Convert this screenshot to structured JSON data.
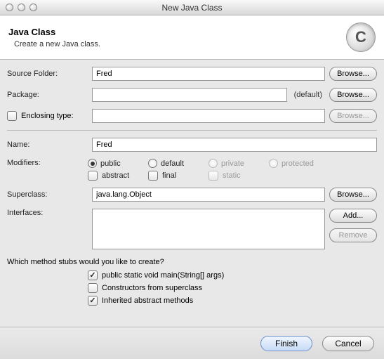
{
  "window": {
    "title": "New Java Class"
  },
  "header": {
    "title": "Java Class",
    "subtitle": "Create a new Java class.",
    "iconLetter": "C"
  },
  "labels": {
    "sourceFolder": "Source Folder:",
    "package": "Package:",
    "enclosingType": "Enclosing type:",
    "name": "Name:",
    "modifiers": "Modifiers:",
    "superclass": "Superclass:",
    "interfaces": "Interfaces:",
    "defaultTag": "(default)",
    "stubsQuestion": "Which method stubs would you like to create?"
  },
  "fields": {
    "sourceFolder": "Fred",
    "package": "",
    "enclosingType": "",
    "name": "Fred",
    "superclass": "java.lang.Object"
  },
  "modifiers": {
    "access": {
      "public": "public",
      "default": "default",
      "private": "private",
      "protected": "protected"
    },
    "abstract": "abstract",
    "final": "final",
    "static": "static"
  },
  "buttons": {
    "browse": "Browse...",
    "add": "Add...",
    "remove": "Remove",
    "finish": "Finish",
    "cancel": "Cancel"
  },
  "stubs": {
    "main": "public static void main(String[] args)",
    "constructors": "Constructors from superclass",
    "inherited": "Inherited abstract methods"
  }
}
